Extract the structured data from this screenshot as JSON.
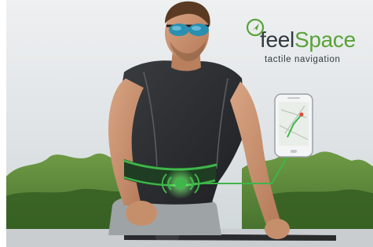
{
  "logo": {
    "brand_prefix": "feel",
    "brand_suffix": "Space",
    "tagline": "tactile navigation",
    "icon": "location-arrow-icon"
  },
  "scene": {
    "subject": "cyclist-with-belt-and-phone",
    "device_icon": "smartphone-map-icon"
  },
  "colors": {
    "brand_green": "#5aa337",
    "belt_green": "#3fb54a",
    "text_dark": "#2f3a3f"
  }
}
